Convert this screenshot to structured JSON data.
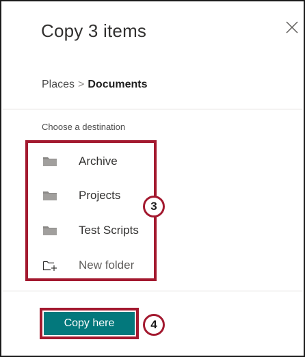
{
  "dialog": {
    "title": "Copy 3 items",
    "close_icon": "close-icon"
  },
  "breadcrumb": {
    "root": "Places",
    "separator": ">",
    "current": "Documents"
  },
  "destination": {
    "label": "Choose a destination",
    "items": [
      {
        "label": "Archive",
        "icon": "folder-icon"
      },
      {
        "label": "Projects",
        "icon": "folder-icon"
      },
      {
        "label": "Test Scripts",
        "icon": "folder-icon"
      }
    ],
    "new_folder": {
      "label": "New folder",
      "icon": "new-folder-icon"
    }
  },
  "actions": {
    "copy_here_label": "Copy here"
  },
  "callouts": {
    "step_3": "3",
    "step_4": "4"
  },
  "colors": {
    "accent": "#03787c",
    "callout": "#a3192f",
    "folder": "#8a8886"
  }
}
